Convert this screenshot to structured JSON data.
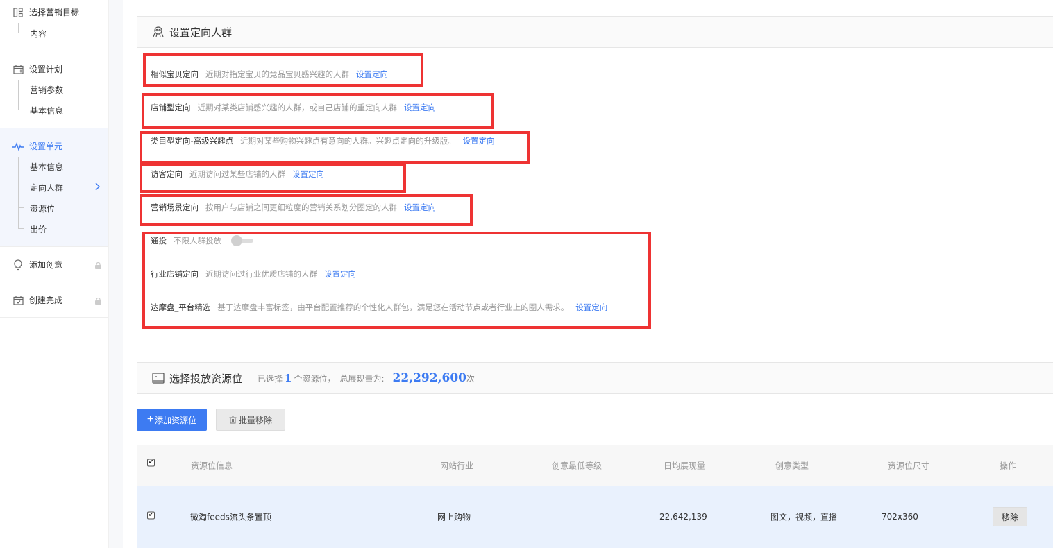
{
  "sidebar": {
    "groups": [
      {
        "title": "选择营销目标",
        "icon": "grid-icon",
        "items": [
          "内容"
        ]
      },
      {
        "title": "设置计划",
        "icon": "calendar-icon",
        "items": [
          "营销参数",
          "基本信息"
        ]
      },
      {
        "title": "设置单元",
        "icon": "pulse-icon",
        "items": [
          "基本信息",
          "定向人群",
          "资源位",
          "出价"
        ]
      },
      {
        "title": "添加创意",
        "icon": "bulb-icon",
        "items": []
      },
      {
        "title": "创建完成",
        "icon": "calendar-check-icon",
        "items": []
      }
    ]
  },
  "targeting": {
    "title": "设置定向人群",
    "rows": [
      {
        "label": "相似宝贝定向",
        "desc": "近期对指定宝贝的竞品宝贝感兴趣的人群",
        "link": "设置定向"
      },
      {
        "label": "店铺型定向",
        "desc": "近期对某类店铺感兴趣的人群，或自己店铺的重定向人群",
        "link": "设置定向"
      },
      {
        "label": "类目型定向-高级兴趣点",
        "desc": "近期对某些购物兴趣点有意向的人群。兴趣点定向的升级版。",
        "link": "设置定向"
      },
      {
        "label": "访客定向",
        "desc": "近期访问过某些店铺的人群",
        "link": "设置定向"
      },
      {
        "label": "营销场景定向",
        "desc": "按用户与店铺之间更细粒度的营销关系划分圈定的人群",
        "link": "设置定向"
      },
      {
        "label": "通投",
        "desc": "不限人群投放",
        "link": ""
      },
      {
        "label": "行业店铺定向",
        "desc": "近期访问过行业优质店铺的人群",
        "link": "设置定向"
      },
      {
        "label": "达摩盘_平台精选",
        "desc": "基于达摩盘丰富标签，由平台配置推荐的个性化人群包，满足您在活动节点或者行业上的圈人需求。",
        "link": "设置定向"
      }
    ]
  },
  "resources": {
    "title": "选择投放资源位",
    "selected_prefix": "已选择",
    "selected_count": "1",
    "selected_suffix": "个资源位，",
    "total_label": "总展现量为:",
    "total_value": "22,292,600",
    "total_unit": "次",
    "add_button": "添加资源位",
    "batch_remove_button": "批量移除",
    "columns": [
      "资源位信息",
      "网站行业",
      "创意最低等级",
      "日均展现量",
      "创意类型",
      "资源位尺寸",
      "操作"
    ],
    "rows": [
      {
        "name": "微淘feeds流头条置顶",
        "industry": "网上购物",
        "min_level": "-",
        "daily_views": "22,642,139",
        "creative_types": "图文，视频，直播",
        "size": "702x360",
        "action": "移除"
      }
    ]
  },
  "colors": {
    "accent": "#3d7bf2",
    "highlight_box": "#ee3333",
    "row_selected": "#e9f1fd"
  }
}
